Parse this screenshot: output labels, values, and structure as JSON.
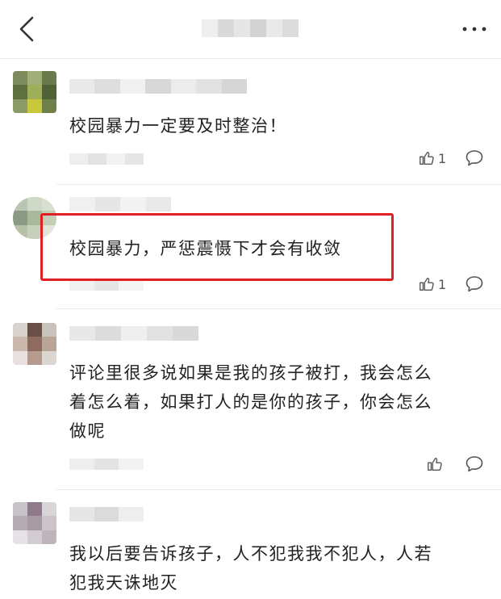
{
  "comments": [
    {
      "text": "校园暴力一定要及时整治！",
      "like_count": "1"
    },
    {
      "text": "校园暴力，严惩震慑下才会有收敛",
      "like_count": "1"
    },
    {
      "text_lines": [
        "评论里很多说如果是我的孩子被打，我会怎么",
        "着怎么着，如果打人的是你的孩子，你会怎么",
        "做呢"
      ],
      "like_count": ""
    },
    {
      "text_lines": [
        "我以后要告诉孩子，人不犯我我不犯人，人若",
        "犯我天诛地灭"
      ]
    }
  ],
  "icons": {
    "back": "chevron-left-icon",
    "more": "more-dots-icon",
    "like": "thumbs-up-icon",
    "reply": "comment-bubble-icon"
  },
  "colors": {
    "highlight": "#e02020",
    "divider": "#ececec"
  }
}
